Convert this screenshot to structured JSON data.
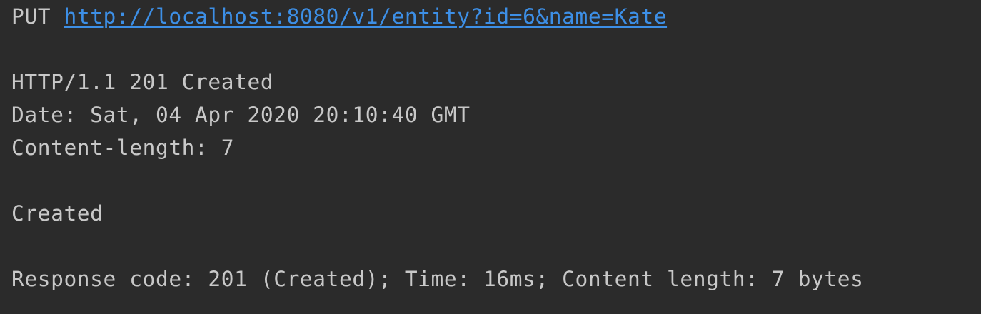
{
  "request": {
    "method": "PUT",
    "url": "http://localhost:8080/v1/entity?id=6&name=Kate"
  },
  "response": {
    "status_line": "HTTP/1.1 201 Created",
    "headers": [
      "Date: Sat, 04 Apr 2020 20:10:40 GMT",
      "Content-length: 7"
    ],
    "body": "Created",
    "summary": "Response code: 201 (Created); Time: 16ms; Content length: 7 bytes"
  },
  "colors": {
    "background": "#2b2b2b",
    "text": "#c8c8c8",
    "link": "#3d8fe6"
  }
}
